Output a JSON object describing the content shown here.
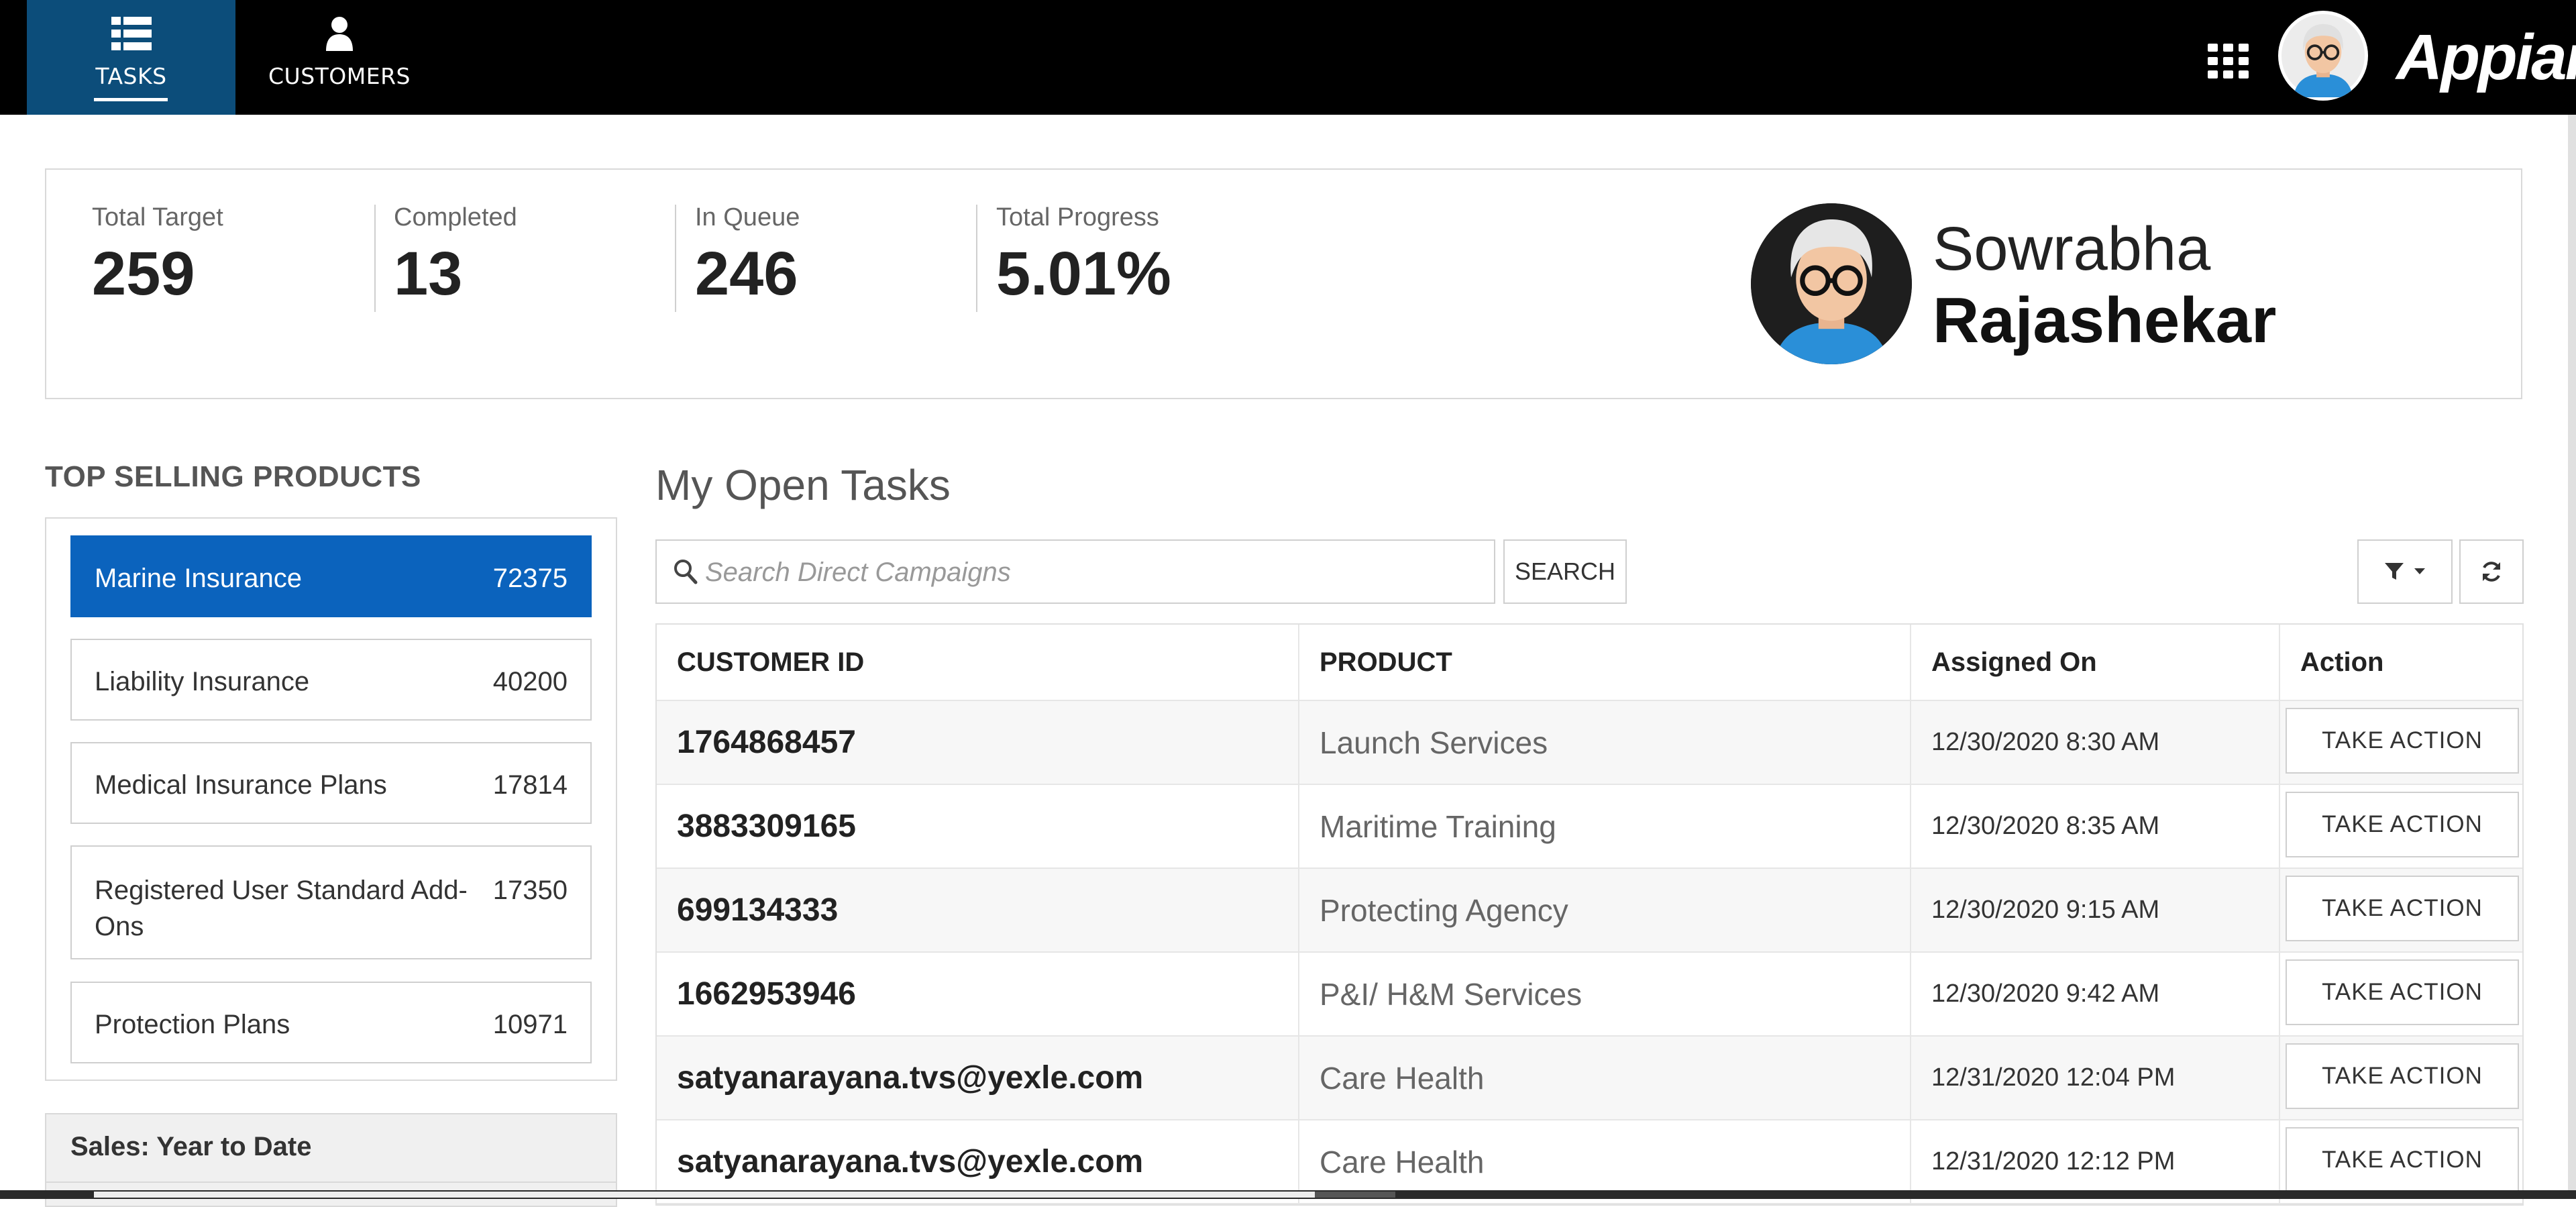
{
  "nav": {
    "tabs": [
      {
        "label": "TASKS",
        "icon": "list-icon",
        "active": true
      },
      {
        "label": "CUSTOMERS",
        "icon": "user-icon",
        "active": false
      }
    ],
    "apps_icon": "grid-icon",
    "logo": "Appian",
    "colors": {
      "bar": "#000000",
      "active_tab": "#0c4d7a"
    }
  },
  "stats": [
    {
      "label": "Total Target",
      "value": "259"
    },
    {
      "label": "Completed",
      "value": "13"
    },
    {
      "label": "In Queue",
      "value": "246"
    },
    {
      "label": "Total Progress",
      "value": "5.01%"
    }
  ],
  "profile": {
    "first_name": "Sowrabha",
    "last_name": "Rajashekar"
  },
  "top_products": {
    "title": "TOP SELLING PRODUCTS",
    "items": [
      {
        "name": "Marine Insurance",
        "value": "72375",
        "selected": true
      },
      {
        "name": "Liability Insurance",
        "value": "40200"
      },
      {
        "name": "Medical Insurance Plans",
        "value": "17814"
      },
      {
        "name": "Registered User Standard Add-Ons",
        "value": "17350"
      },
      {
        "name": "Protection Plans",
        "value": "10971"
      }
    ],
    "accent": "#0b63bd"
  },
  "sales": {
    "title": "Sales: Year to Date"
  },
  "tasks": {
    "title": "My Open Tasks",
    "search_placeholder": "Search Direct Campaigns",
    "search_button": "SEARCH",
    "columns": [
      "CUSTOMER ID",
      "PRODUCT",
      "Assigned On",
      "Action"
    ],
    "rows": [
      {
        "customer_id": "1764868457",
        "product": "Launch Services",
        "assigned_on": "12/30/2020 8:30 AM",
        "action": "TAKE ACTION"
      },
      {
        "customer_id": "3883309165",
        "product": "Maritime Training",
        "assigned_on": "12/30/2020 8:35 AM",
        "action": "TAKE ACTION"
      },
      {
        "customer_id": "699134333",
        "product": "Protecting Agency",
        "assigned_on": "12/30/2020 9:15 AM",
        "action": "TAKE ACTION"
      },
      {
        "customer_id": "1662953946",
        "product": "P&I/ H&M Services",
        "assigned_on": "12/30/2020 9:42 AM",
        "action": "TAKE ACTION"
      },
      {
        "customer_id": "satyanarayana.tvs@yexle.com",
        "product": "Care Health",
        "assigned_on": "12/31/2020 12:04 PM",
        "action": "TAKE ACTION"
      },
      {
        "customer_id": "satyanarayana.tvs@yexle.com",
        "product": "Care Health",
        "assigned_on": "12/31/2020 12:12 PM",
        "action": "TAKE ACTION"
      }
    ]
  }
}
